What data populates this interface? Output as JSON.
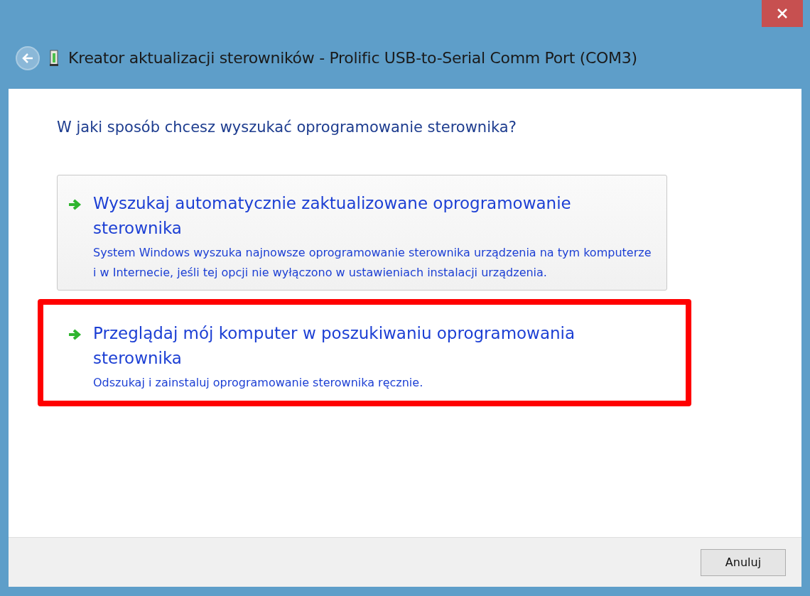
{
  "window": {
    "title": "Kreator aktualizacji sterowników - Prolific USB-to-Serial Comm Port (COM3)"
  },
  "heading": "W jaki sposób chcesz wyszukać oprogramowanie sterownika?",
  "options": [
    {
      "title": "Wyszukaj automatycznie zaktualizowane oprogramowanie sterownika",
      "description": "System Windows wyszuka najnowsze oprogramowanie sterownika urządzenia na tym komputerze i w Internecie, jeśli tej opcji nie wyłączono w ustawieniach instalacji urządzenia.",
      "hovered": true,
      "highlighted": false
    },
    {
      "title": "Przeglądaj mój komputer w poszukiwaniu oprogramowania sterownika",
      "description": "Odszukaj i zainstaluj oprogramowanie sterownika ręcznie.",
      "hovered": false,
      "highlighted": true
    }
  ],
  "buttons": [
    "Anuluj"
  ]
}
